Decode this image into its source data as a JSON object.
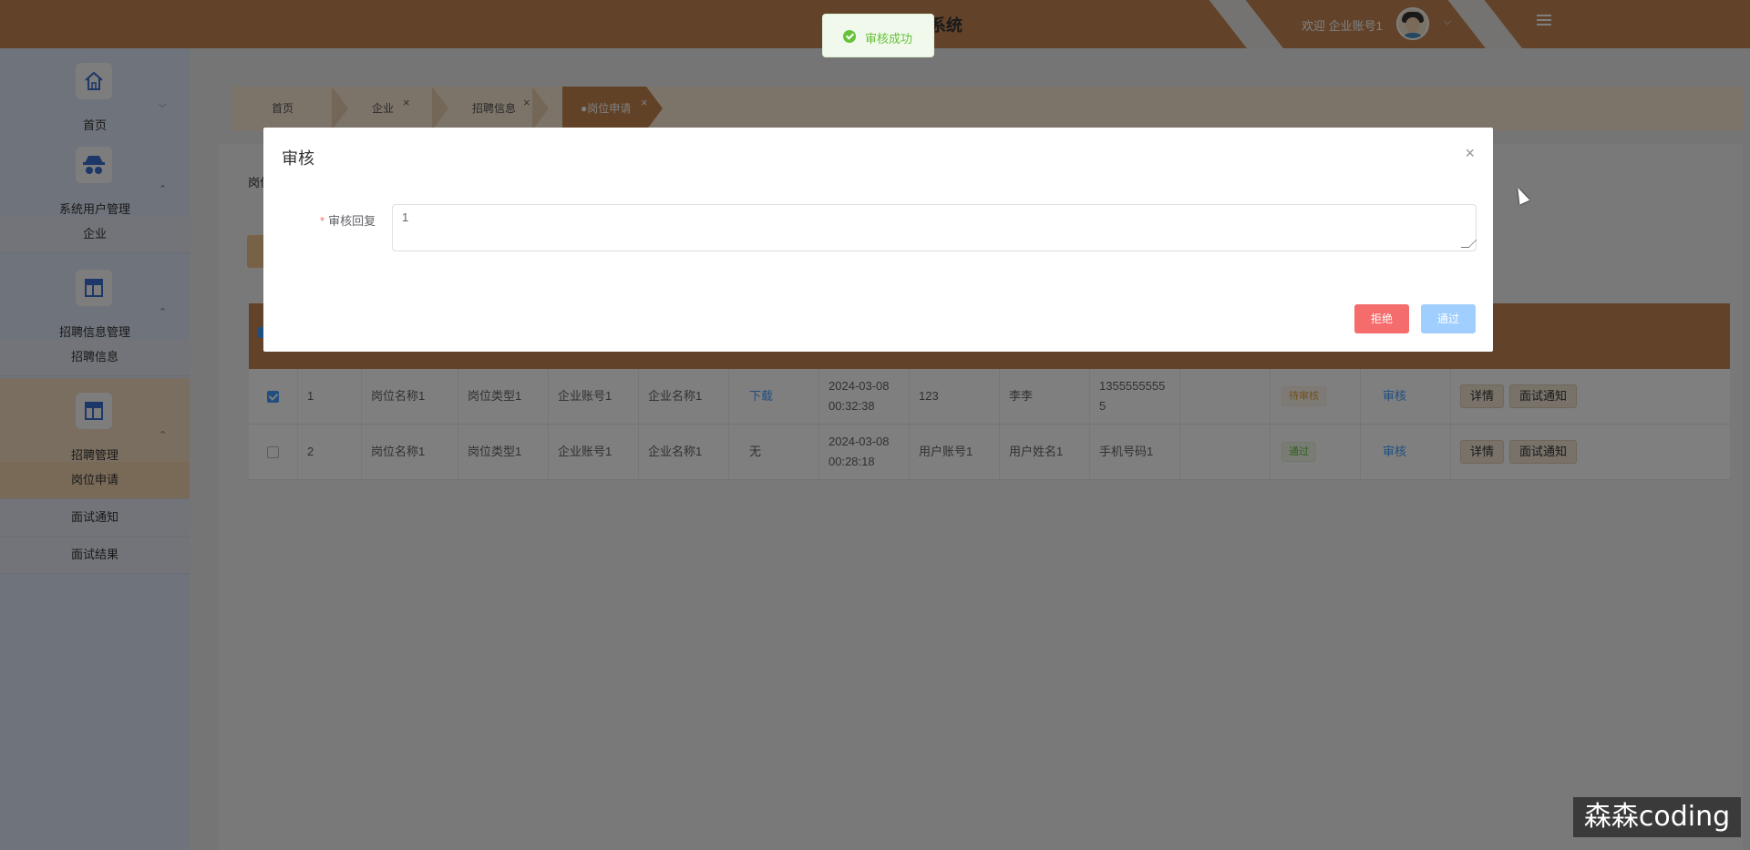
{
  "header": {
    "title": "系统",
    "welcome": "欢迎 企业账号1",
    "chevron": "⌵"
  },
  "sidebar": {
    "groups": [
      {
        "label": "首页",
        "icon": "home-icon",
        "arrow": "⌵",
        "children": []
      },
      {
        "label": "系统用户管理",
        "icon": "user-spy-icon",
        "arrow": "⌃",
        "children": [
          "企业"
        ]
      },
      {
        "label": "招聘信息管理",
        "icon": "layout-icon",
        "arrow": "⌃",
        "children": [
          "招聘信息"
        ]
      },
      {
        "label": "招聘管理",
        "icon": "layout-icon",
        "arrow": "⌃",
        "children": [
          "岗位申请",
          "面试通知",
          "面试结果"
        ]
      }
    ]
  },
  "tabs": [
    {
      "label": "首页",
      "close": ""
    },
    {
      "label": "企业",
      "close": "×"
    },
    {
      "label": "招聘信息",
      "close": "×"
    },
    {
      "label": "●岗位申请",
      "close": "×"
    }
  ],
  "page": {
    "search_label": "岗位"
  },
  "table": {
    "rows": [
      {
        "checked": true,
        "index": "1",
        "post_name": "岗位名称1",
        "post_type": "岗位类型1",
        "company_account": "企业账号1",
        "company_name": "企业名称1",
        "resume": "下载",
        "time_date": "2024-03-08",
        "time_clock": "00:32:38",
        "user_account": "123",
        "user_name": "李李",
        "phone_a": "1355555555",
        "phone_b": "5",
        "status": "待审核",
        "audit": "审核",
        "detail": "详情",
        "notify": "面试通知"
      },
      {
        "checked": false,
        "index": "2",
        "post_name": "岗位名称1",
        "post_type": "岗位类型1",
        "company_account": "企业账号1",
        "company_name": "企业名称1",
        "resume": "无",
        "time_date": "2024-03-08",
        "time_clock": "00:28:18",
        "user_account": "用户账号1",
        "user_name": "用户姓名1",
        "phone_a": "手机号码1",
        "phone_b": "",
        "status": "通过",
        "audit": "审核",
        "detail": "详情",
        "notify": "面试通知"
      }
    ]
  },
  "dialog": {
    "title": "审核",
    "close": "×",
    "field_required_mark": "*",
    "field_label": "审核回复",
    "field_value": "1",
    "reject_label": "拒绝",
    "pass_label": "通过"
  },
  "toast": {
    "message": "审核成功",
    "type": "success"
  },
  "watermark": "森森coding",
  "colors": {
    "brand": "#c48755",
    "success": "#67c23a",
    "danger": "#f56c6c",
    "primary": "#409eff"
  }
}
